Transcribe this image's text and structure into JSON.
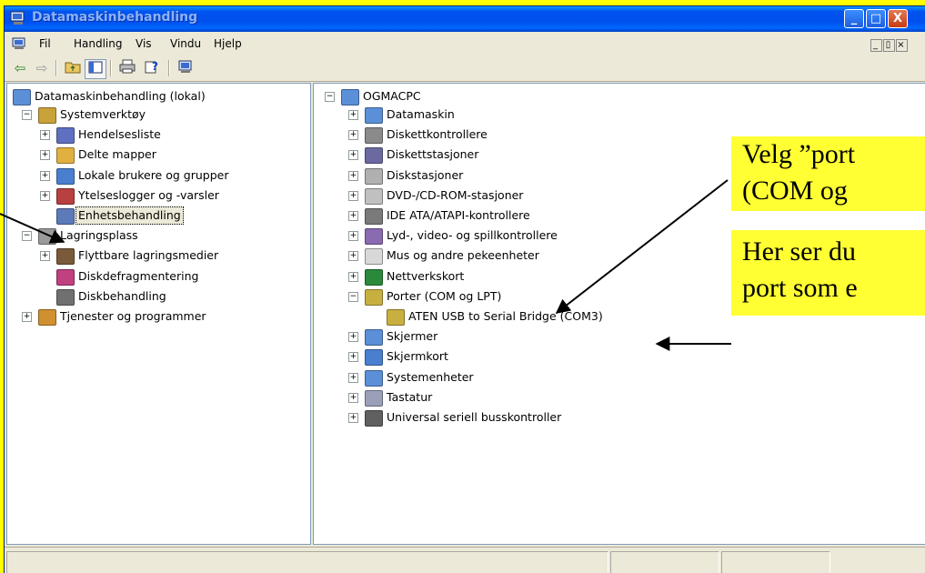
{
  "window": {
    "title": "Datamaskinbehandling",
    "buttons": {
      "minimize": "_",
      "maximize": "□",
      "close": "X"
    }
  },
  "menu": {
    "items": [
      "Fil",
      "Handling",
      "Vis",
      "Vindu",
      "Hjelp"
    ],
    "mdi_buttons": [
      "_",
      "▯",
      "×"
    ]
  },
  "toolbar": {
    "icons": [
      "back-arrow-icon",
      "forward-arrow-icon",
      "up-folder-icon",
      "show-hide-tree-icon",
      "print-icon",
      "help-icon",
      "properties-icon"
    ]
  },
  "left_tree": {
    "root": "Datamaskinbehandling (lokal)",
    "items": [
      {
        "label": "Systemverktøy",
        "expander": "−",
        "icon": "tools-icon"
      },
      {
        "label": "Hendelsesliste",
        "expander": "+",
        "icon": "event-viewer-icon"
      },
      {
        "label": "Delte mapper",
        "expander": "+",
        "icon": "shared-folders-icon"
      },
      {
        "label": "Lokale brukere og grupper",
        "expander": "+",
        "icon": "users-icon"
      },
      {
        "label": "Ytelseslogger og -varsler",
        "expander": "+",
        "icon": "performance-icon"
      },
      {
        "label": "Enhetsbehandling",
        "expander": "",
        "icon": "device-manager-icon"
      },
      {
        "label": "Lagringsplass",
        "expander": "−",
        "icon": "storage-icon"
      },
      {
        "label": "Flyttbare lagringsmedier",
        "expander": "+",
        "icon": "removable-media-icon"
      },
      {
        "label": "Diskdefragmentering",
        "expander": "",
        "icon": "defrag-icon"
      },
      {
        "label": "Diskbehandling",
        "expander": "",
        "icon": "disk-management-icon"
      },
      {
        "label": "Tjenester og programmer",
        "expander": "+",
        "icon": "services-icon"
      }
    ]
  },
  "right_tree": {
    "root": "OGMACPC",
    "root_expander": "−",
    "items": [
      {
        "label": "Datamaskin",
        "expander": "+",
        "icon": "computer-icon"
      },
      {
        "label": "Diskettkontrollere",
        "expander": "+",
        "icon": "floppy-controller-icon"
      },
      {
        "label": "Diskettstasjoner",
        "expander": "+",
        "icon": "floppy-drive-icon"
      },
      {
        "label": "Diskstasjoner",
        "expander": "+",
        "icon": "disk-drive-icon"
      },
      {
        "label": "DVD-/CD-ROM-stasjoner",
        "expander": "+",
        "icon": "cdrom-icon"
      },
      {
        "label": "IDE ATA/ATAPI-kontrollere",
        "expander": "+",
        "icon": "ide-controller-icon"
      },
      {
        "label": "Lyd-, video- og spillkontrollere",
        "expander": "+",
        "icon": "sound-icon"
      },
      {
        "label": "Mus og andre pekeenheter",
        "expander": "+",
        "icon": "mouse-icon"
      },
      {
        "label": "Nettverkskort",
        "expander": "+",
        "icon": "network-card-icon"
      },
      {
        "label": "Porter (COM og LPT)",
        "expander": "−",
        "icon": "port-icon"
      },
      {
        "label": "ATEN USB to Serial Bridge (COM3)",
        "expander": "",
        "icon": "port-icon"
      },
      {
        "label": "Skjermer",
        "expander": "+",
        "icon": "monitor-icon"
      },
      {
        "label": "Skjermkort",
        "expander": "+",
        "icon": "display-adapter-icon"
      },
      {
        "label": "Systemenheter",
        "expander": "+",
        "icon": "system-devices-icon"
      },
      {
        "label": "Tastatur",
        "expander": "+",
        "icon": "keyboard-icon"
      },
      {
        "label": "Universal seriell busskontroller",
        "expander": "+",
        "icon": "usb-icon"
      }
    ]
  },
  "callouts": {
    "first_line1": "Velg ”port",
    "first_line2": "(COM og",
    "second_line1": "Her ser du",
    "second_line2": "port som e"
  },
  "colors": {
    "callout_bg": "#ffff33",
    "titlebar": "#0053ee",
    "window_face": "#ece9d8"
  }
}
